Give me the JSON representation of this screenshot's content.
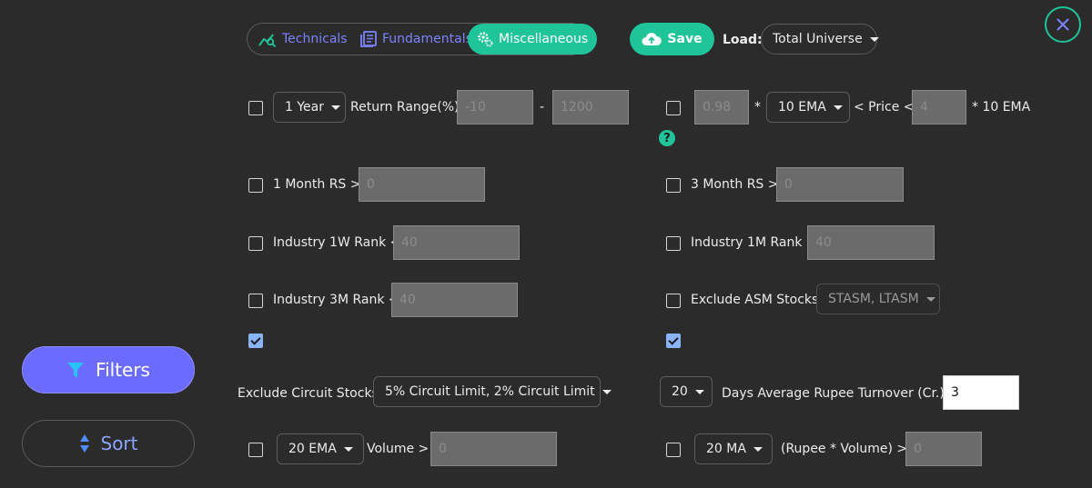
{
  "tabs": [
    {
      "label": "Technicals",
      "icon": "chart-search-icon"
    },
    {
      "label": "Fundamentals",
      "icon": "document-icon"
    },
    {
      "label": "Miscellaneous",
      "icon": "gears-icon",
      "active": true
    }
  ],
  "toolbar": {
    "save_label": "Save",
    "load_label": "Load:",
    "load_value": "Total Universe"
  },
  "sidebar": {
    "filters_label": "Filters",
    "sort_label": "Sort"
  },
  "left": {
    "return": {
      "period": "1 Year",
      "label": "Return Range(%):",
      "min_placeholder": "-10",
      "dash": "-",
      "max_placeholder": "1200"
    },
    "rs1m": {
      "label": "1 Month RS >",
      "placeholder": "0"
    },
    "ind1w": {
      "label": "Industry 1W Rank <",
      "placeholder": "40"
    },
    "ind3m": {
      "label": "Industry 3M Rank <",
      "placeholder": "40"
    },
    "circuit": {
      "label": "Exclude Circuit Stocks:",
      "value": "5% Circuit Limit, 2% Circuit Limit"
    },
    "ema_volume": {
      "ema": "20 EMA",
      "label": "Volume >",
      "placeholder": "0"
    }
  },
  "right": {
    "ema_price": {
      "min_placeholder": "0.98",
      "star": "*",
      "ema": "10 EMA",
      "mid_label": "< Price <",
      "max_placeholder": "4",
      "suffix": "* 10 EMA",
      "help": "?"
    },
    "rs3m": {
      "label": "3 Month RS >",
      "placeholder": "0"
    },
    "ind1m": {
      "label": "Industry 1M Rank <",
      "placeholder": "40"
    },
    "asm": {
      "label": "Exclude ASM Stocks:",
      "value": "STASM, LTASM"
    },
    "turnover": {
      "days": "20",
      "label": "Days Average Rupee Turnover (Cr.) >",
      "value": "3"
    },
    "ma_rupee": {
      "ma": "20 MA",
      "label": "(Rupee * Volume) >",
      "placeholder": "0"
    }
  },
  "colors": {
    "accent": "#1fc499",
    "primary": "#6b6cff",
    "background": "#2b2b2b"
  }
}
